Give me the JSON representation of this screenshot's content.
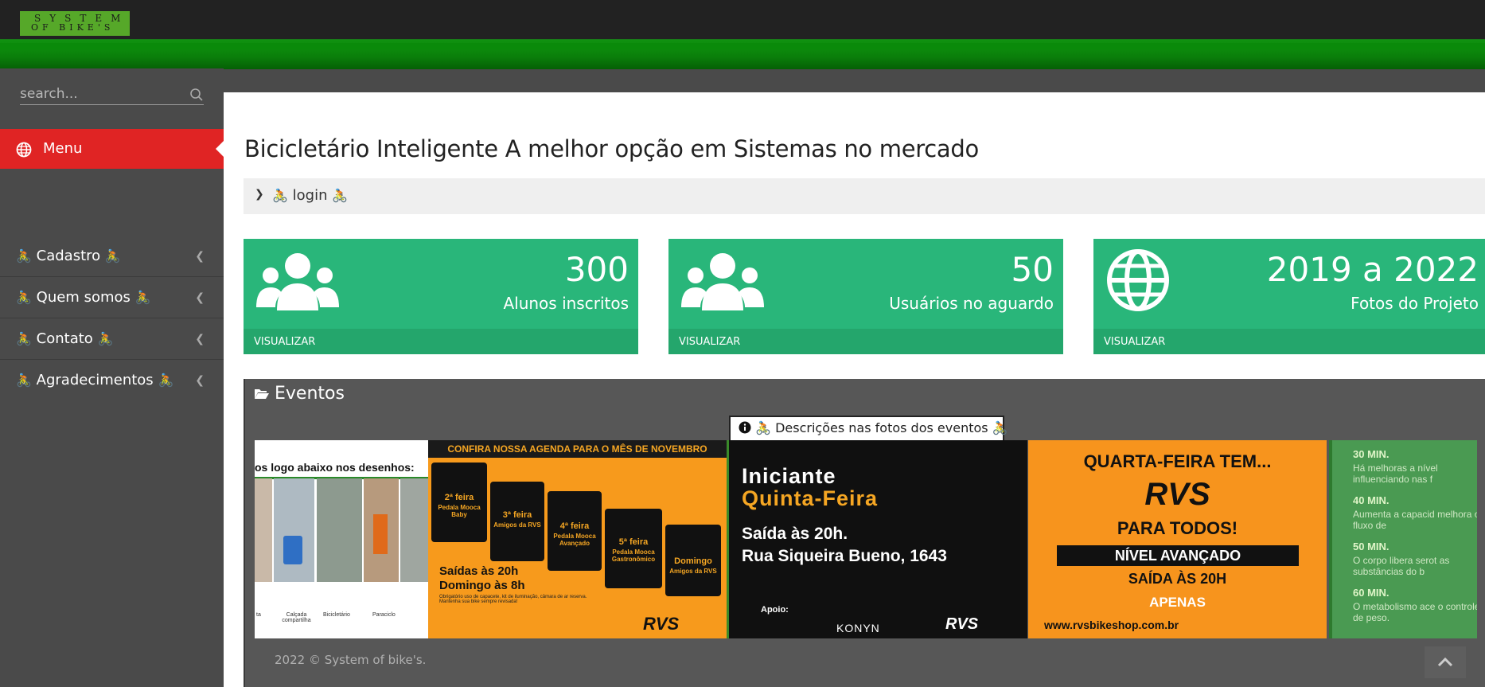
{
  "logo": {
    "line1": "SYSTEM",
    "line2": "OF BIKE'S"
  },
  "search": {
    "placeholder": "search..."
  },
  "sidebar": {
    "active": "Menu",
    "items": [
      {
        "label": "Cadastro"
      },
      {
        "label": "Quem somos"
      },
      {
        "label": "Contato"
      },
      {
        "label": "Agradecimentos"
      }
    ]
  },
  "page": {
    "title": "Bicicletário Inteligente A melhor opção em Sistemas no mercado",
    "breadcrumb": "login"
  },
  "cards": [
    {
      "value": "300",
      "label": "Alunos inscritos",
      "action": "VISUALIZAR",
      "icon": "users-icon"
    },
    {
      "value": "50",
      "label": "Usuários no aguardo",
      "action": "VISUALIZAR",
      "icon": "users-icon"
    },
    {
      "value": "2019 a 2022",
      "label": "Fotos do Projeto",
      "action": "VISUALIZAR",
      "icon": "globe-icon"
    }
  ],
  "events": {
    "title": "Eventos",
    "caption": "Descrições nas fotos dos eventos",
    "slides": {
      "s1": {
        "heading": "os logo abaixo nos desenhos:",
        "labels": [
          "ta",
          "Calçada compartilha",
          "Bicicletário",
          "Paraciclo"
        ]
      },
      "s2": {
        "banner": "CONFIRA NOSSA AGENDA PARA O MÊS DE NOVEMBRO",
        "days": [
          "2ª feira",
          "3ª feira",
          "4ª feira",
          "5ª feira",
          "Domingo"
        ],
        "rides": [
          "Pedala Mooca Baby",
          "Amigos da RVS",
          "Pedala Mooca Avançado",
          "Pedala Mooca Gastronômico",
          "Amigos da RVS"
        ],
        "times": "Saídas às 20h",
        "sunday": "Domingo às 8h",
        "note": "Obrigatório uso de capacete, kit de iluminação, câmara de ar reserva. Mantenha sua bike sempre revisada!",
        "brand": "RVS"
      },
      "s3": {
        "title": "Iniciante",
        "day": "Quinta-Feira",
        "line1": "Saída às 20h.",
        "line2": "Rua Siqueira Bueno, 1643",
        "apoio": "Apoio:",
        "sponsor": "KONYN",
        "brand": "RVS"
      },
      "s4": {
        "title": "QUARTA-FEIRA TEM...",
        "brand": "RVS",
        "line1": "PARA TODOS!",
        "level": "NÍVEL AVANÇADO",
        "time": "SAÍDA ÀS 20H",
        "only": "APENAS",
        "url": "www.rvsbikeshop.com.br"
      },
      "s5": {
        "items": [
          "30 MIN.",
          "40 MIN.",
          "50 MIN.",
          "60 MIN."
        ],
        "texts": [
          "Há melhoras a nível influenciando nas f",
          "Aumenta a capacid melhora o fluxo de",
          "O corpo libera serot as substâncias do b",
          "O metabolismo ace o controle de peso."
        ]
      }
    }
  },
  "footer": {
    "copyright": "2022 © System of bike's."
  },
  "colors": {
    "card": "#29b67a",
    "active": "#e02424",
    "top": "#222222",
    "green": "#0a8a0a"
  }
}
